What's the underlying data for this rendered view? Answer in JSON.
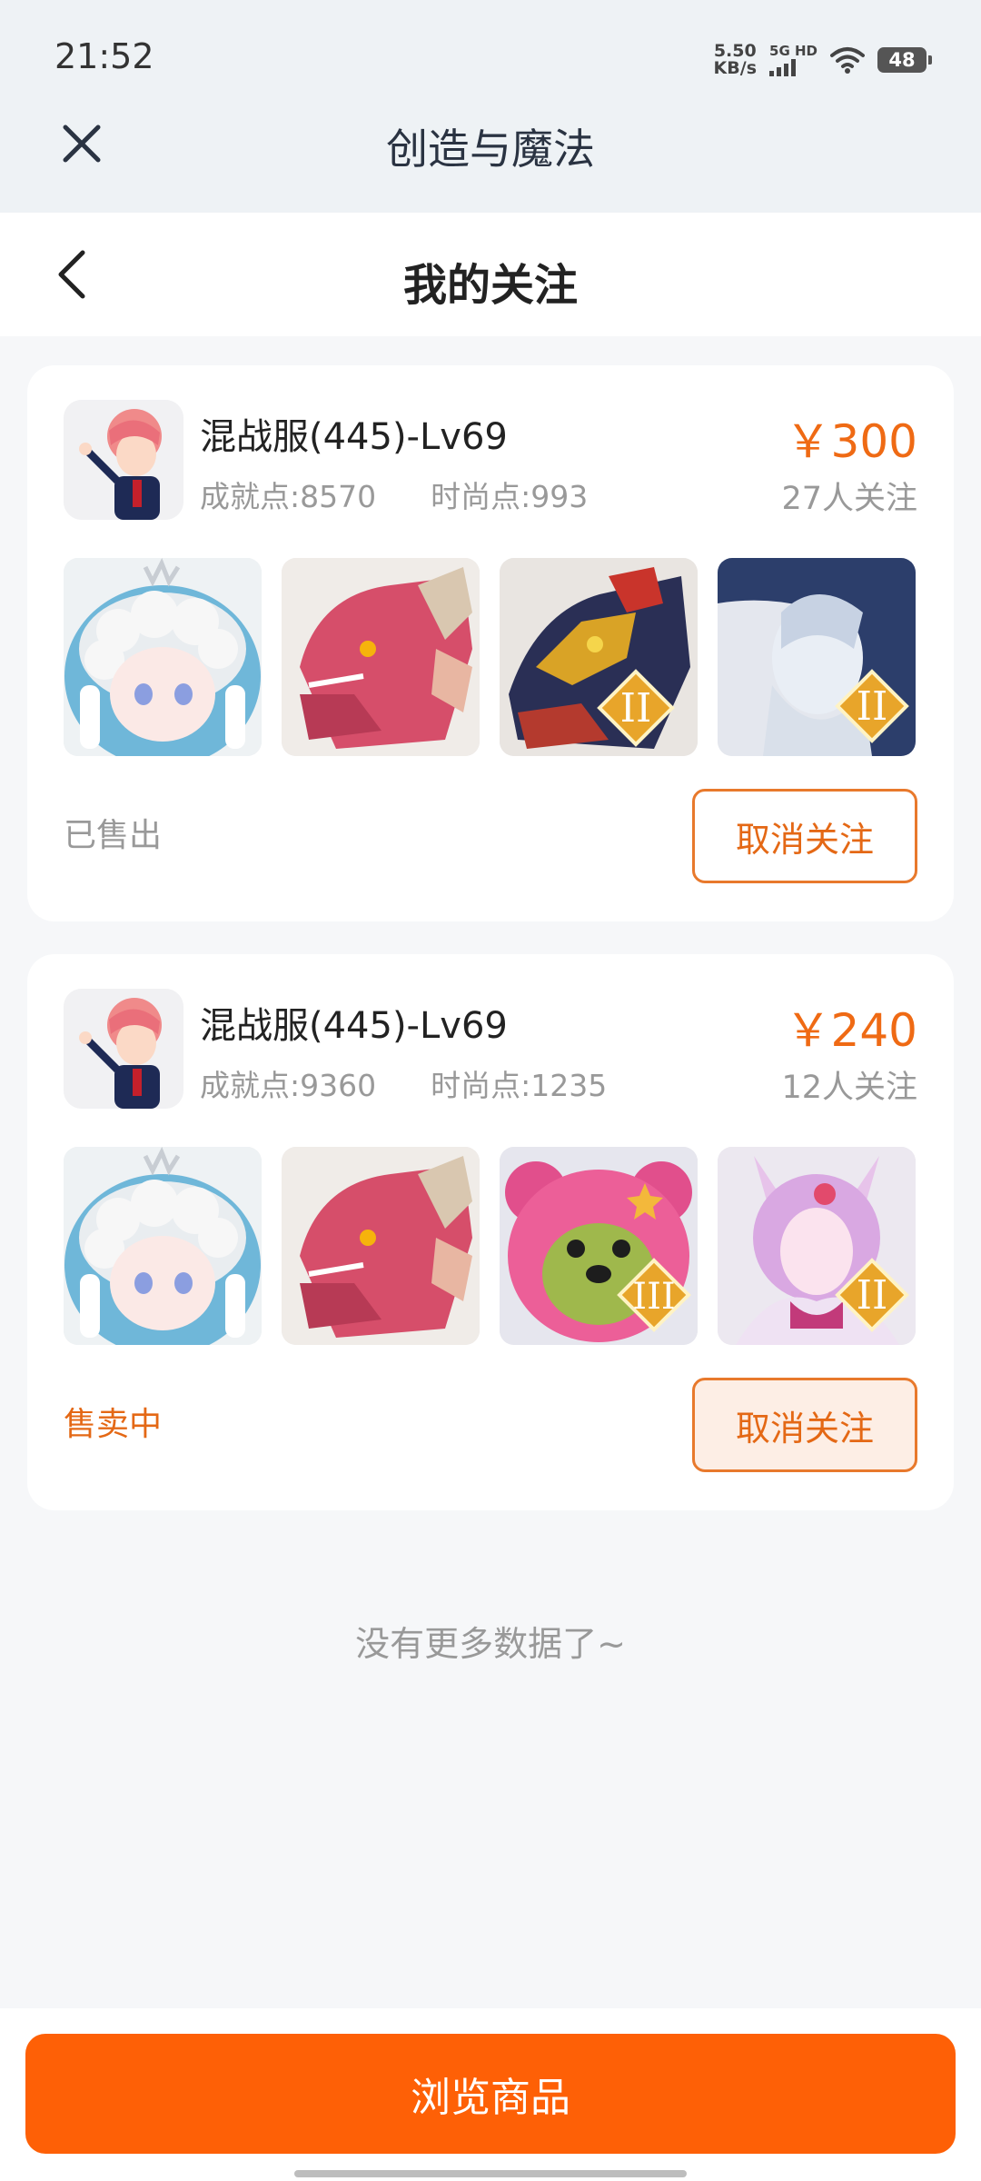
{
  "status_bar": {
    "time": "21:52",
    "net_speed_value": "5.50",
    "net_speed_unit": "KB/s",
    "network": "5G HD",
    "battery": "48"
  },
  "mini_app": {
    "title": "创造与魔法"
  },
  "page": {
    "title": "我的关注"
  },
  "listings": [
    {
      "server": "混战服(445)-Lv69",
      "achievement": "成就点:8570",
      "fashion": "时尚点:993",
      "price": "￥300",
      "followers": "27人关注",
      "status": "已售出",
      "status_color": "#999999",
      "action": "取消关注",
      "items": [
        "cloud-hair-character",
        "red-dragon",
        "golden-dragon",
        "ice-warrior"
      ],
      "item_badges": [
        "",
        "",
        "II",
        "II"
      ]
    },
    {
      "server": "混战服(445)-Lv69",
      "achievement": "成就点:9360",
      "fashion": "时尚点:1235",
      "price": "￥240",
      "followers": "12人关注",
      "status": "售卖中",
      "status_color": "#e46815",
      "action": "取消关注",
      "items": [
        "cloud-hair-character",
        "red-dragon",
        "pink-bear",
        "fox-spirit"
      ],
      "item_badges": [
        "",
        "",
        "III",
        "II"
      ]
    }
  ],
  "footer": {
    "no_more": "没有更多数据了~",
    "browse_button": "浏览商品"
  },
  "colors": {
    "accent": "#fe6006",
    "price": "#ef6a14"
  }
}
